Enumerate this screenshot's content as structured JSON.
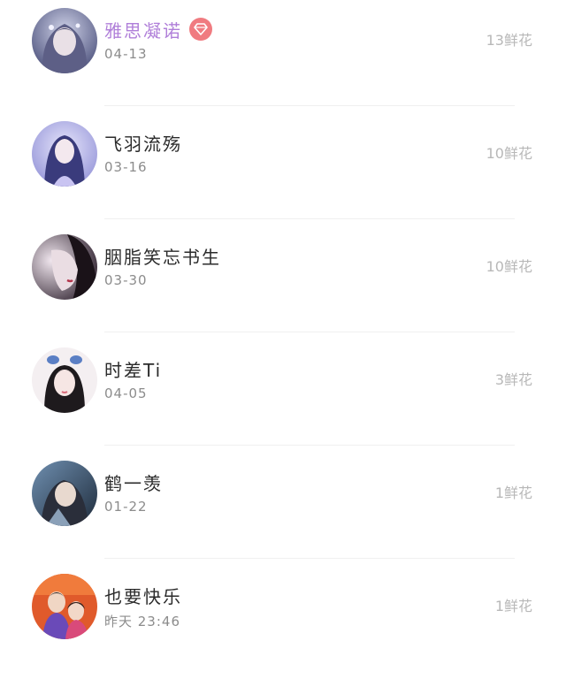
{
  "records": [
    {
      "name": "雅思凝诺",
      "time": "04-13",
      "flowers": "13鲜花",
      "vip": true,
      "badge_icon": "diamond-icon",
      "name_color": "#b07fd9",
      "badge_color": "#f07b80"
    },
    {
      "name": "飞羽流殇",
      "time": "03-16",
      "flowers": "10鲜花",
      "vip": false
    },
    {
      "name": "胭脂笑忘书生",
      "time": "03-30",
      "flowers": "10鲜花",
      "vip": false
    },
    {
      "name": "时差Ti",
      "time": "04-05",
      "flowers": "3鲜花",
      "vip": false
    },
    {
      "name": "鹤一羡",
      "time": "01-22",
      "flowers": "1鲜花",
      "vip": false
    },
    {
      "name": "也要快乐",
      "time": "昨天 23:46",
      "flowers": "1鲜花",
      "vip": false
    }
  ]
}
